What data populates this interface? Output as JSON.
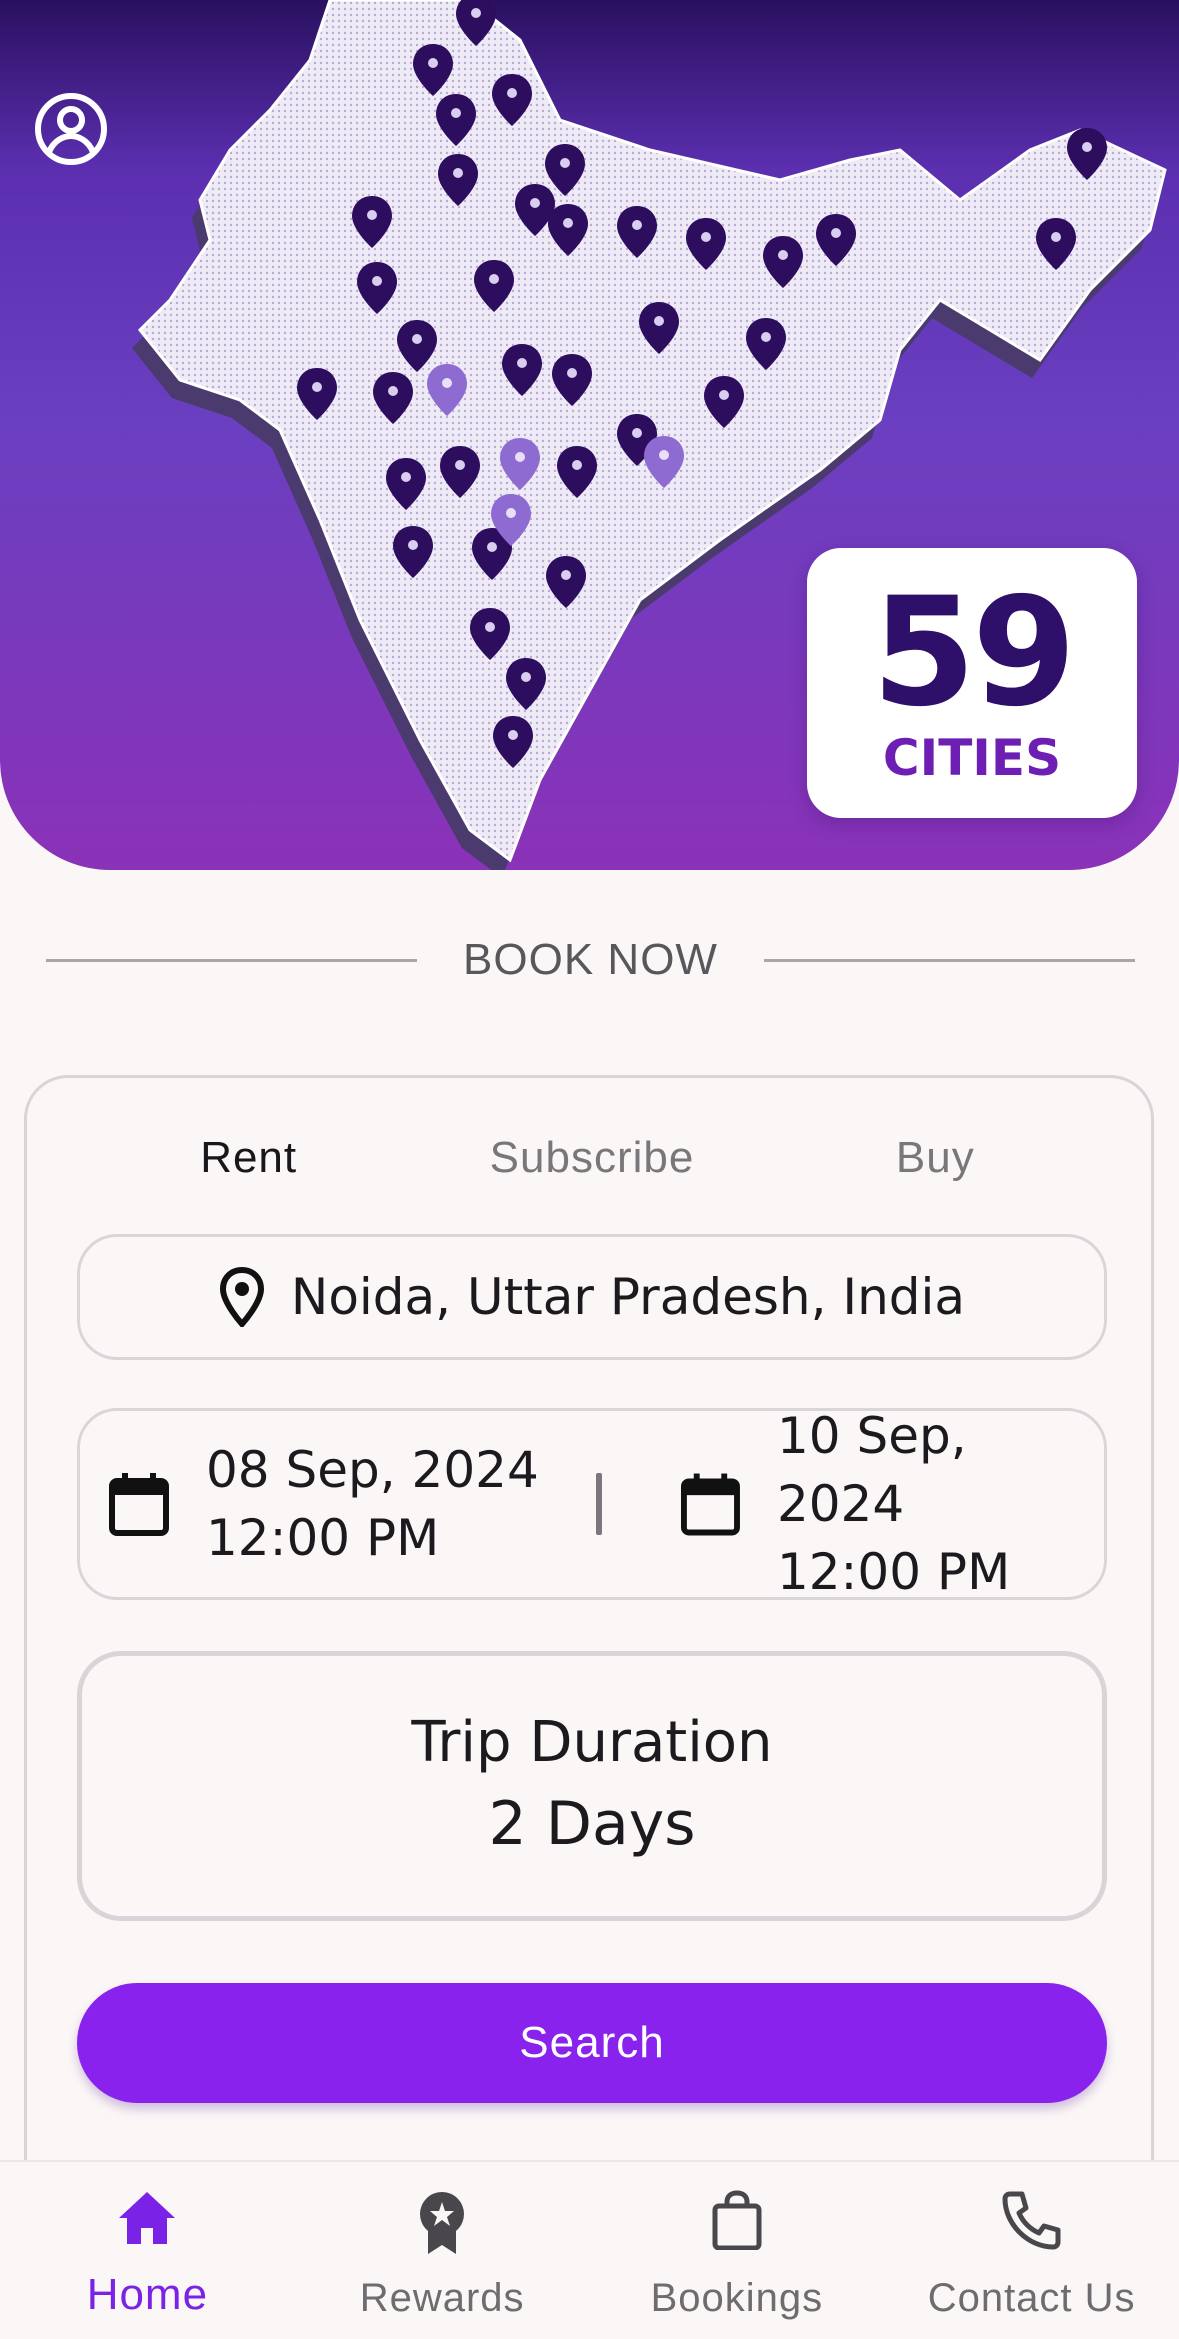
{
  "colors": {
    "accent": "#8a22ee",
    "hero_top": "#2a1060",
    "hero_bottom": "#8a32b8",
    "cities_number": "#2e0f6a",
    "cities_label": "#6d1fb3",
    "background": "#fbf7f6"
  },
  "header": {
    "profile_icon": "account-circle-icon"
  },
  "hero": {
    "image": "india-map-with-location-pins",
    "cities_count": "59",
    "cities_label": "CITIES"
  },
  "book_now": {
    "heading": "BOOK NOW"
  },
  "booking": {
    "tabs": [
      {
        "label": "Rent",
        "active": true
      },
      {
        "label": "Subscribe",
        "active": false
      },
      {
        "label": "Buy",
        "active": false
      }
    ],
    "location": {
      "icon": "location-pin-icon",
      "value": "Noida, Uttar Pradesh, India"
    },
    "start": {
      "icon": "calendar-icon",
      "date": "08 Sep, 2024",
      "time": "12:00 PM"
    },
    "end": {
      "icon": "calendar-icon",
      "date": "10 Sep, 2024",
      "time": "12:00 PM"
    },
    "trip_duration": {
      "title": "Trip Duration",
      "value": "2 Days"
    },
    "search_label": "Search"
  },
  "bottom_nav": {
    "items": [
      {
        "label": "Home",
        "icon": "home-icon",
        "active": true
      },
      {
        "label": "Rewards",
        "icon": "rewards-badge-icon",
        "active": false
      },
      {
        "label": "Bookings",
        "icon": "shopping-bag-icon",
        "active": false
      },
      {
        "label": "Contact Us",
        "icon": "phone-icon",
        "active": false
      }
    ]
  }
}
